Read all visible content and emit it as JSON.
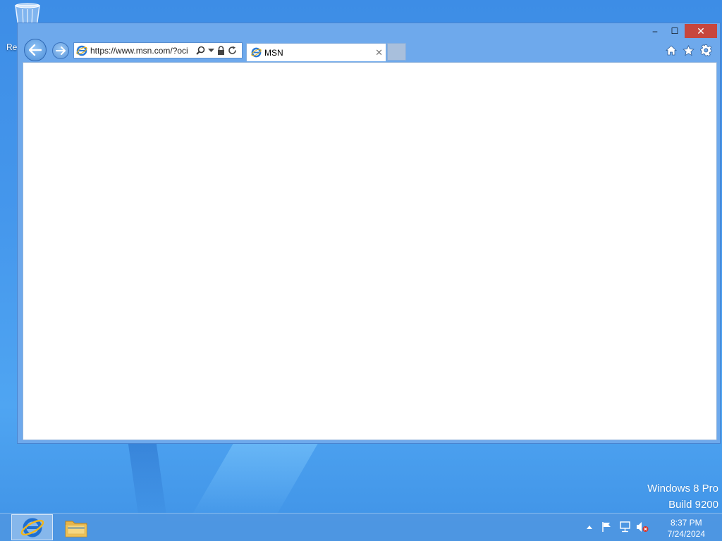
{
  "desktop": {
    "recycle_bin_label": "Re",
    "watermark_line1": "Windows 8 Pro",
    "watermark_line2": "Build 9200"
  },
  "browser": {
    "address": "https://www.msn.com/?oci",
    "tab_title": "MSN",
    "caption": {
      "minimize": "–",
      "maximize": "☐",
      "close": "✕"
    },
    "icons": [
      "back-arrow-icon",
      "forward-arrow-icon",
      "ie-icon",
      "search-icon",
      "dropdown-icon",
      "lock-icon",
      "refresh-icon",
      "tab-close-icon",
      "home-icon",
      "favorites-star-icon",
      "settings-gear-icon"
    ]
  },
  "taskbar": {
    "pinned": [
      "internet-explorer",
      "file-explorer"
    ],
    "clock_time": "8:37 PM",
    "clock_date": "7/24/2024"
  },
  "colors": {
    "desktop_bg": "#4597ec",
    "window_frame": "#6ea9ec",
    "close_button": "#c7463d",
    "taskbar": "#5096e1"
  }
}
